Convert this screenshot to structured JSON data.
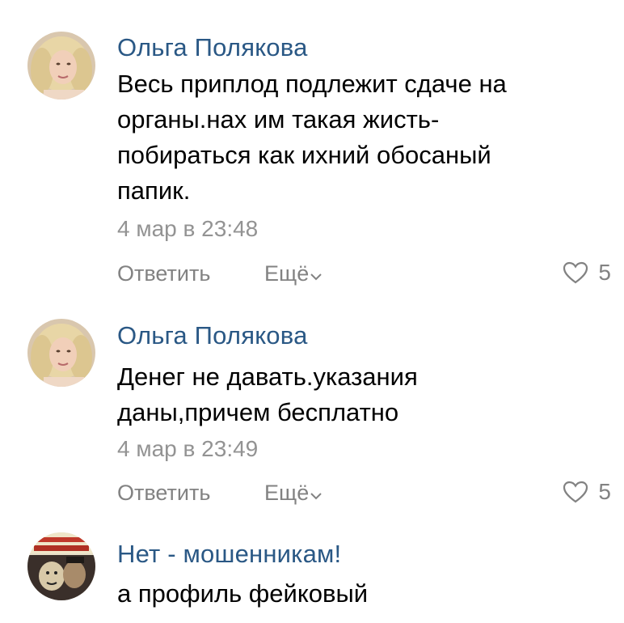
{
  "colors": {
    "author": "#2a5885",
    "meta": "#939393",
    "action": "#828282",
    "text": "#000000"
  },
  "comments": [
    {
      "author": "Ольга Полякова",
      "text": "Весь приплод подлежит сдаче на\nорганы.нах им такая жисть-\nпобираться как ихний обосаный\nпапик.",
      "time": "4 мар в 23:48",
      "reply_label": "Ответить",
      "more_label": "Ещё",
      "likes": "5",
      "avatar_icon": "user-photo-avatar"
    },
    {
      "author": "Ольга Полякова",
      "text": "Денег не давать.указания\nданы,причем бесплатно",
      "time": "4 мар в 23:49",
      "reply_label": "Ответить",
      "more_label": "Ещё",
      "likes": "5",
      "avatar_icon": "user-photo-avatar"
    },
    {
      "author": "Нет - мошенникам!",
      "text": "а профиль фейковый",
      "avatar_icon": "poster-avatar"
    }
  ]
}
